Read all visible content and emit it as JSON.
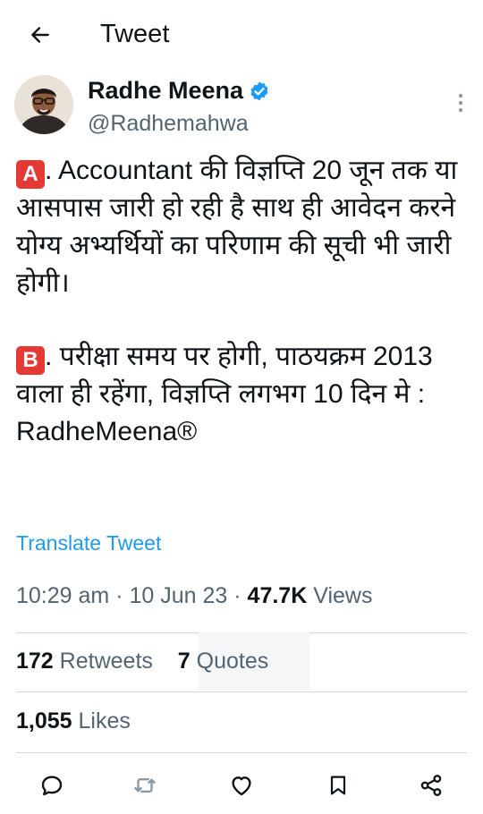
{
  "header": {
    "title": "Tweet",
    "back_icon": "arrow-left-icon"
  },
  "author": {
    "display_name": "Radhe Meena",
    "handle": "@Radhemahwa",
    "verified": true,
    "verified_color": "#1d9bf0"
  },
  "tweet": {
    "paragraphs": [
      {
        "badge": "A",
        "text": ". Accountant की विज्ञप्ति 20 जून तक या आसपास जारी हो रही है साथ ही आवेदन करने योग्य अभ्यर्थियों का परिणाम की सूची भी जारी होगी।"
      },
      {
        "badge": "B",
        "text": ". परीक्षा समय पर होगी, पाठयक्रम 2013 वाला ही रहेंगा, विज्ञप्ति लगभग 10 दिन मे : RadheMeena",
        "suffix_symbol": "®"
      }
    ]
  },
  "translate_label": "Translate Tweet",
  "meta": {
    "time": "10:29 am",
    "separator": "·",
    "date": "10 Jun 23",
    "views_count": "47.7K",
    "views_label": "Views"
  },
  "stats": {
    "retweets_count": "172",
    "retweets_label": "Retweets",
    "quotes_count": "7",
    "quotes_label": "Quotes",
    "likes_count": "1,055",
    "likes_label": "Likes"
  },
  "actions": [
    "reply-icon",
    "retweet-icon",
    "like-icon",
    "bookmark-icon",
    "share-icon"
  ],
  "colors": {
    "link": "#1d9bf0",
    "secondary_text": "#536471",
    "text": "#0f1419",
    "badge": "#e53935"
  }
}
